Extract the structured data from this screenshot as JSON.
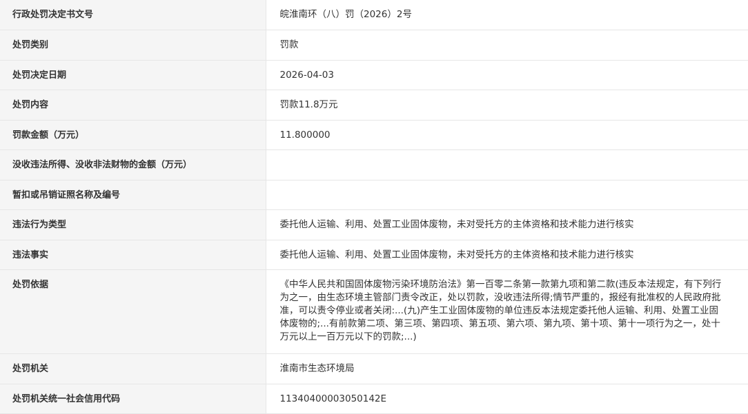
{
  "rows": [
    {
      "label": "行政处罚决定书文号",
      "value": "皖淮南环（八）罚（2026）2号"
    },
    {
      "label": "处罚类别",
      "value": "罚款"
    },
    {
      "label": "处罚决定日期",
      "value": "2026-04-03"
    },
    {
      "label": "处罚内容",
      "value": "罚款11.8万元"
    },
    {
      "label": "罚款金额（万元）",
      "value": "11.800000"
    },
    {
      "label": "没收违法所得、没收非法财物的金额（万元）",
      "value": ""
    },
    {
      "label": "暂扣或吊销证照名称及编号",
      "value": ""
    },
    {
      "label": "违法行为类型",
      "value": "委托他人运输、利用、处置工业固体废物，未对受托方的主体资格和技术能力进行核实"
    },
    {
      "label": "违法事实",
      "value": "委托他人运输、利用、处置工业固体废物，未对受托方的主体资格和技术能力进行核实"
    },
    {
      "label": "处罚依据",
      "value": "《中华人民共和国固体废物污染环境防治法》第一百零二条第一款第九项和第二款(违反本法规定，有下列行为之一，由生态环境主管部门责令改正，处以罚款，没收违法所得;情节严重的，报经有批准权的人民政府批准，可以责令停业或者关闭:...(九)产生工业固体废物的单位违反本法规定委托他人运输、利用、处置工业固体废物的;...有前款第二项、第三项、第四项、第五项、第六项、第九项、第十项、第十一项行为之一，处十万元以上一百万元以下的罚款;...)"
    },
    {
      "label": "处罚机关",
      "value": "淮南市生态环境局"
    },
    {
      "label": "处罚机关统一社会信用代码",
      "value": "11340400003050142E"
    }
  ]
}
